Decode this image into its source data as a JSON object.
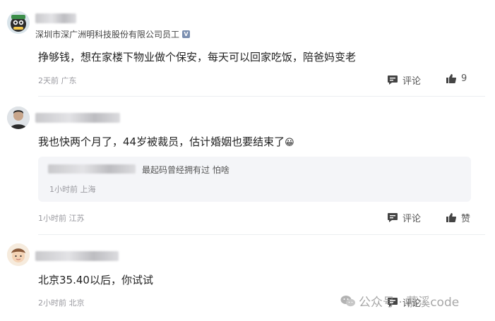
{
  "comments": [
    {
      "user_title": "深圳市深广洲明科技股份有限公司员工",
      "verified_badge": "V",
      "text": "挣够钱，想在家楼下物业做个保安，每天可以回家吃饭，陪爸妈变老",
      "time": "2天前",
      "location": "广东",
      "comment_label": "评论",
      "like_count": "9"
    },
    {
      "text": "我也快两个月了，44岁被裁员，估计婚姻也要结束了",
      "emoji": "😀",
      "reply": {
        "text": "最起码曾经拥有过 怕啥",
        "time": "1小时前",
        "location": "上海"
      },
      "time": "1小时前",
      "location": "江苏",
      "comment_label": "评论",
      "like_label": "赞"
    },
    {
      "text": "北京35.40以后，你试试",
      "time": "2小时前",
      "location": "北京",
      "comment_label": "评论"
    }
  ],
  "watermark": {
    "text": "公众号 · 慕溪code",
    "icon": "wechat-icon"
  },
  "colors": {
    "reply_bg": "#f4f5f8",
    "divider": "#eceef1",
    "meta": "#9a9aa0"
  }
}
